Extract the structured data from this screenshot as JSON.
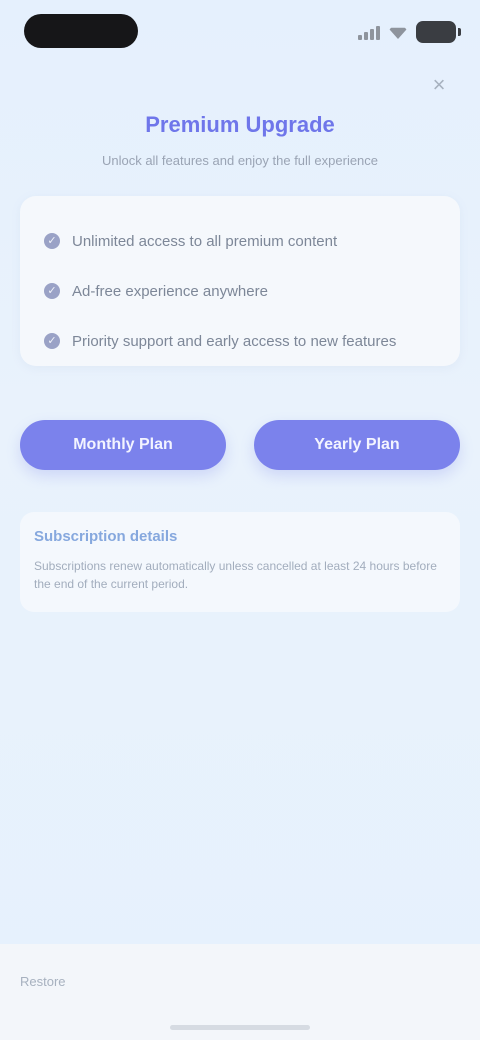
{
  "status_bar": {
    "time": "",
    "icons": [
      "signal-icon",
      "wifi-icon",
      "battery-icon"
    ]
  },
  "close_button": {
    "icon": "close-icon",
    "glyph": "×"
  },
  "header": {
    "title": "Premium Upgrade",
    "subtitle": "Unlock all features and enjoy the full experience"
  },
  "features": [
    {
      "icon": "check-icon",
      "label": "Unlimited access to all premium content"
    },
    {
      "icon": "check-icon",
      "label": "Ad-free experience anywhere"
    },
    {
      "icon": "check-icon",
      "label": "Priority support and early access to new features"
    }
  ],
  "buttons": {
    "primary_label": "Monthly Plan",
    "secondary_label": "Yearly Plan"
  },
  "info": {
    "title": "Subscription details",
    "body": "Subscriptions renew automatically unless cancelled at least 24 hours before the end of the current period."
  },
  "footer": {
    "link_label": "Restore"
  },
  "colors": {
    "accent": "#7b82ec",
    "title": "#6f76ea",
    "background": "#e8f2fd"
  }
}
